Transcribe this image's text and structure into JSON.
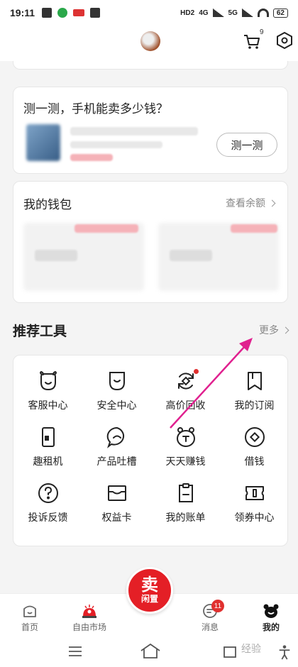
{
  "status_bar": {
    "time": "19:11",
    "hd": "HD2",
    "signal_4g": "4G",
    "signal_5g": "5G",
    "battery": "62"
  },
  "header": {
    "cart_badge": "9"
  },
  "test_card": {
    "title": "测一测，手机能卖多少钱？",
    "button_label": "测一测"
  },
  "wallet_card": {
    "title": "我的钱包",
    "link_label": "查看余额"
  },
  "tools_section": {
    "title": "推荐工具",
    "more_label": "更多",
    "items": [
      {
        "label": "客服中心",
        "icon": "bear-face-icon"
      },
      {
        "label": "安全中心",
        "icon": "shield-icon"
      },
      {
        "label": "高价回收",
        "icon": "recycle-icon"
      },
      {
        "label": "我的订阅",
        "icon": "bookmark-icon"
      },
      {
        "label": "趣租机",
        "icon": "phone-icon"
      },
      {
        "label": "产品吐槽",
        "icon": "feedback-bubble-icon"
      },
      {
        "label": "天天赚钱",
        "icon": "coin-bear-icon"
      },
      {
        "label": "借钱",
        "icon": "loan-icon"
      },
      {
        "label": "投诉反馈",
        "icon": "question-icon"
      },
      {
        "label": "权益卡",
        "icon": "card-icon"
      },
      {
        "label": "我的账单",
        "icon": "bill-icon"
      },
      {
        "label": "领券中心",
        "icon": "coupon-icon"
      }
    ]
  },
  "tab_bar": {
    "home": "首页",
    "market": "自由市场",
    "sell_main": "卖",
    "sell_sub": "闲置",
    "messages": "消息",
    "messages_badge": "11",
    "mine": "我的"
  },
  "watermark": "经验",
  "colors": {
    "accent_red": "#e41f26",
    "arrow_magenta": "#e0208f"
  }
}
